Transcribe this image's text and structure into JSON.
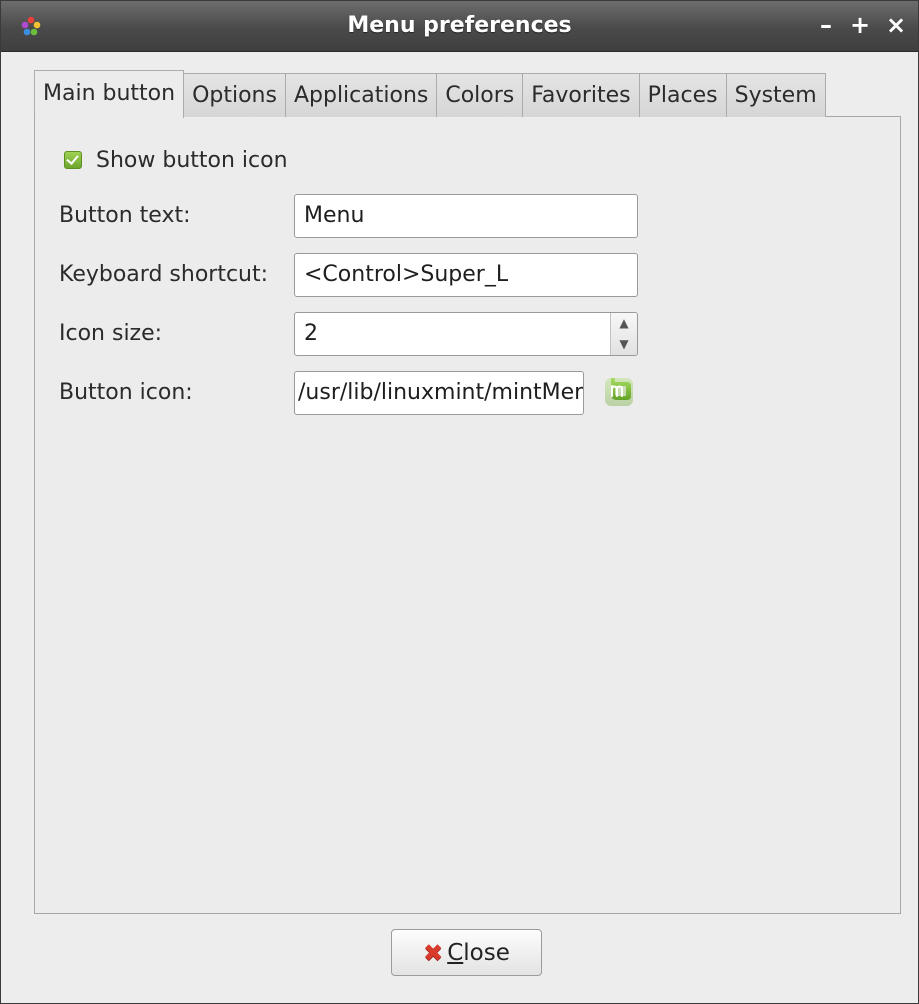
{
  "window": {
    "title": "Menu preferences",
    "minimize": "–",
    "maximize": "+",
    "close": "×"
  },
  "tabs": [
    {
      "label": "Main button",
      "active": true
    },
    {
      "label": "Options",
      "active": false
    },
    {
      "label": "Applications",
      "active": false
    },
    {
      "label": "Colors",
      "active": false
    },
    {
      "label": "Favorites",
      "active": false
    },
    {
      "label": "Places",
      "active": false
    },
    {
      "label": "System",
      "active": false
    }
  ],
  "main_button": {
    "show_icon": {
      "label": "Show button icon",
      "checked": true
    },
    "button_text": {
      "label": "Button text:",
      "value": "Menu"
    },
    "keyboard_shortcut": {
      "label": "Keyboard shortcut:",
      "value": "<Control>Super_L"
    },
    "icon_size": {
      "label": "Icon size:",
      "value": "2"
    },
    "button_icon": {
      "label": "Button icon:",
      "value": "/usr/lib/linuxmint/mintMenu/mintMenu.png",
      "icon": "linux-mint-logo-icon"
    }
  },
  "footer": {
    "close_label": "Close",
    "close_icon": "red-x-icon"
  },
  "colors": {
    "accent_green": "#6ea52c",
    "close_red": "#d83a2c"
  }
}
